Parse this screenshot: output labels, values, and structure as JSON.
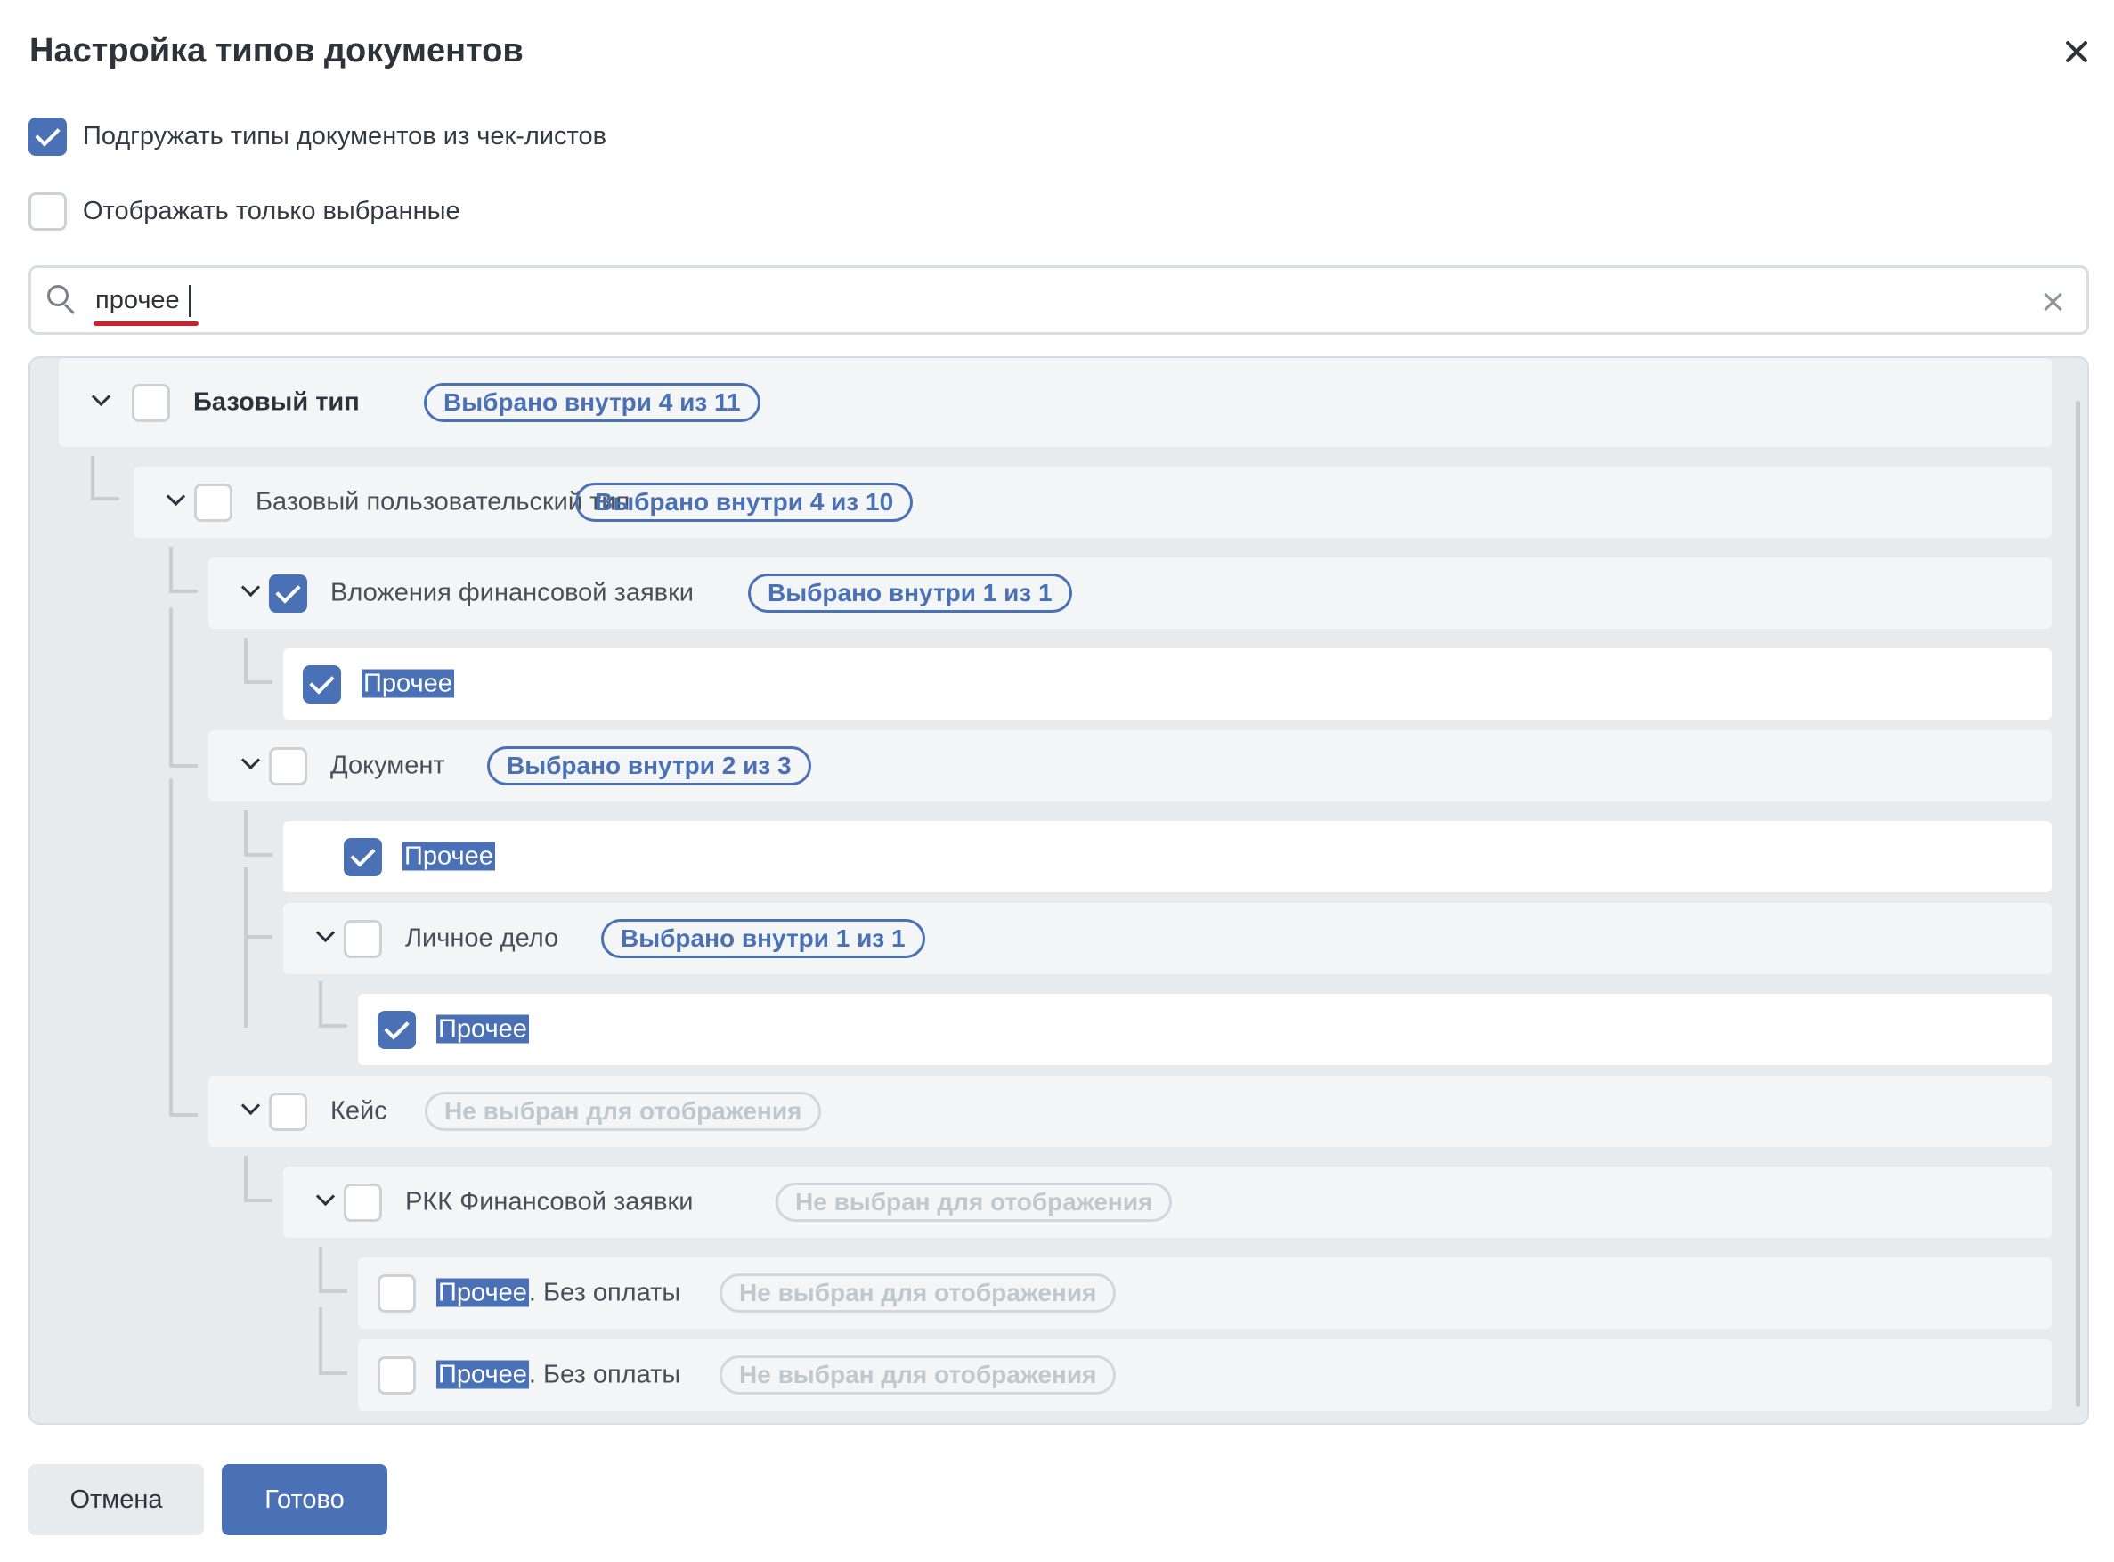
{
  "dialog": {
    "title": "Настройка типов документов"
  },
  "options": {
    "load_from_checklists": {
      "label": "Подгружать типы документов из чек-листов",
      "checked": true
    },
    "show_only_selected": {
      "label": "Отображать только выбранные",
      "checked": false
    }
  },
  "search": {
    "value": "прочее"
  },
  "tree": [
    {
      "label": "Базовый тип",
      "badge": "Выбрано внутри 4 из 11",
      "checked": false
    },
    {
      "label": "Базовый пользовательский тип",
      "badge": "Выбрано внутри 4 из 10",
      "checked": false
    },
    {
      "label": "Вложения финансовой заявки",
      "badge": "Выбрано внутри 1 из 1",
      "checked": true
    },
    {
      "label": "Прочее",
      "checked": true
    },
    {
      "label": "Документ",
      "badge": "Выбрано внутри 2 из 3",
      "checked": false
    },
    {
      "label": "Прочее",
      "checked": true
    },
    {
      "label": "Личное дело",
      "badge": "Выбрано внутри 1 из 1",
      "checked": false
    },
    {
      "label": "Прочее",
      "checked": true
    },
    {
      "label": "Кейс",
      "badge": "Не выбран для отображения",
      "checked": false
    },
    {
      "label": "РКК Финансовой заявки",
      "badge": "Не выбран для отображения",
      "checked": false
    },
    {
      "label_highlight": "Прочее",
      "label_rest": ". Без оплаты",
      "badge": "Не выбран для отображения",
      "checked": false
    },
    {
      "label_highlight": "Прочее",
      "label_rest": ". Без оплаты",
      "badge": "Не выбран для отображения",
      "checked": false
    }
  ],
  "footer": {
    "cancel": "Отмена",
    "done": "Готово"
  },
  "colors": {
    "accent": "#4a70b5",
    "highlight_search": "#d0202a"
  }
}
